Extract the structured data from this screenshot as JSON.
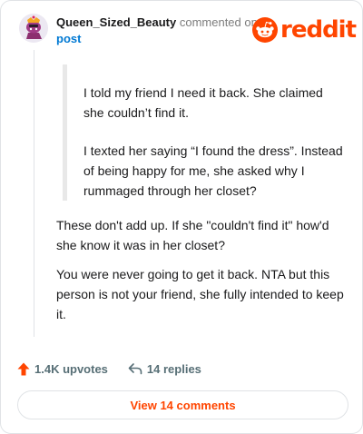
{
  "header": {
    "username": "Queen_Sized_Beauty",
    "action_text": "commented on",
    "post_link": "post",
    "logo_text": "reddit",
    "brand_color": "#ff4500",
    "avatar_icon": "snoo-avatar-icon"
  },
  "comment": {
    "quote": [
      "I told my friend I need it back. She claimed she couldn’t find it.",
      "I texted her saying “I found the dress”. Instead of being happy for me, she asked why I rummaged through her closet?"
    ],
    "paragraphs": [
      "These don't add up. If she \"couldn't find it\" how'd she know it was in her closet?",
      "You were never going to get it back. NTA but this person is not your friend, she fully intended to keep it."
    ]
  },
  "actions": {
    "upvotes": "1.4K upvotes",
    "replies": "14 replies",
    "upvote_icon": "upvote-arrow-icon",
    "reply_icon": "reply-arrow-icon"
  },
  "footer": {
    "view_comments": "View 14 comments"
  }
}
